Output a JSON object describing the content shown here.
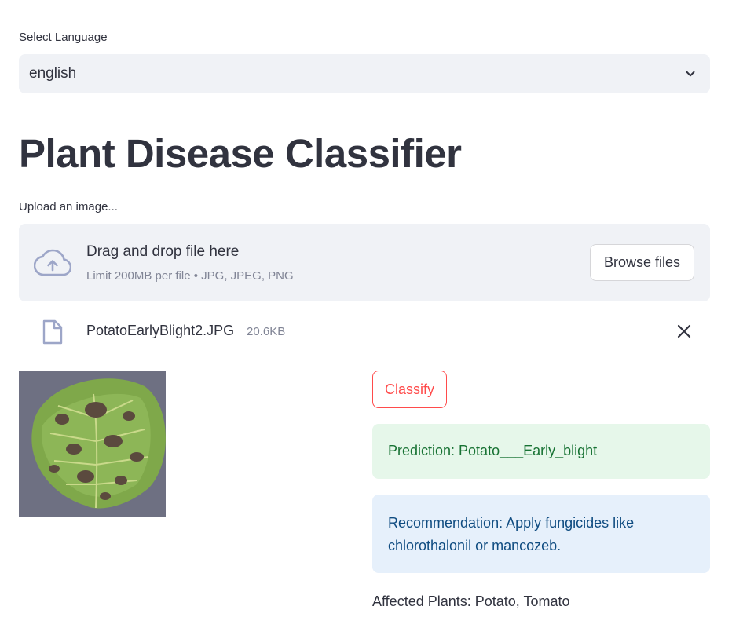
{
  "language": {
    "label": "Select Language",
    "selected": "english"
  },
  "title": "Plant Disease Classifier",
  "uploader": {
    "label": "Upload an image...",
    "drag_text": "Drag and drop file here",
    "limit_text": "Limit 200MB per file • JPG, JPEG, PNG",
    "browse_label": "Browse files"
  },
  "file": {
    "name": "PotatoEarlyBlight2.JPG",
    "size": "20.6KB"
  },
  "classify_label": "Classify",
  "prediction": "Prediction: Potato___Early_blight",
  "recommendation": "Recommendation: Apply fungicides like chlorothalonil or mancozeb.",
  "affected": "Affected Plants: Potato, Tomato",
  "colors": {
    "primary": "#ff4b4b",
    "success_bg": "#e6f7ea",
    "info_bg": "#e6f0fb"
  },
  "icons": [
    "chevron-down-icon",
    "cloud-upload-icon",
    "file-icon",
    "close-icon"
  ]
}
